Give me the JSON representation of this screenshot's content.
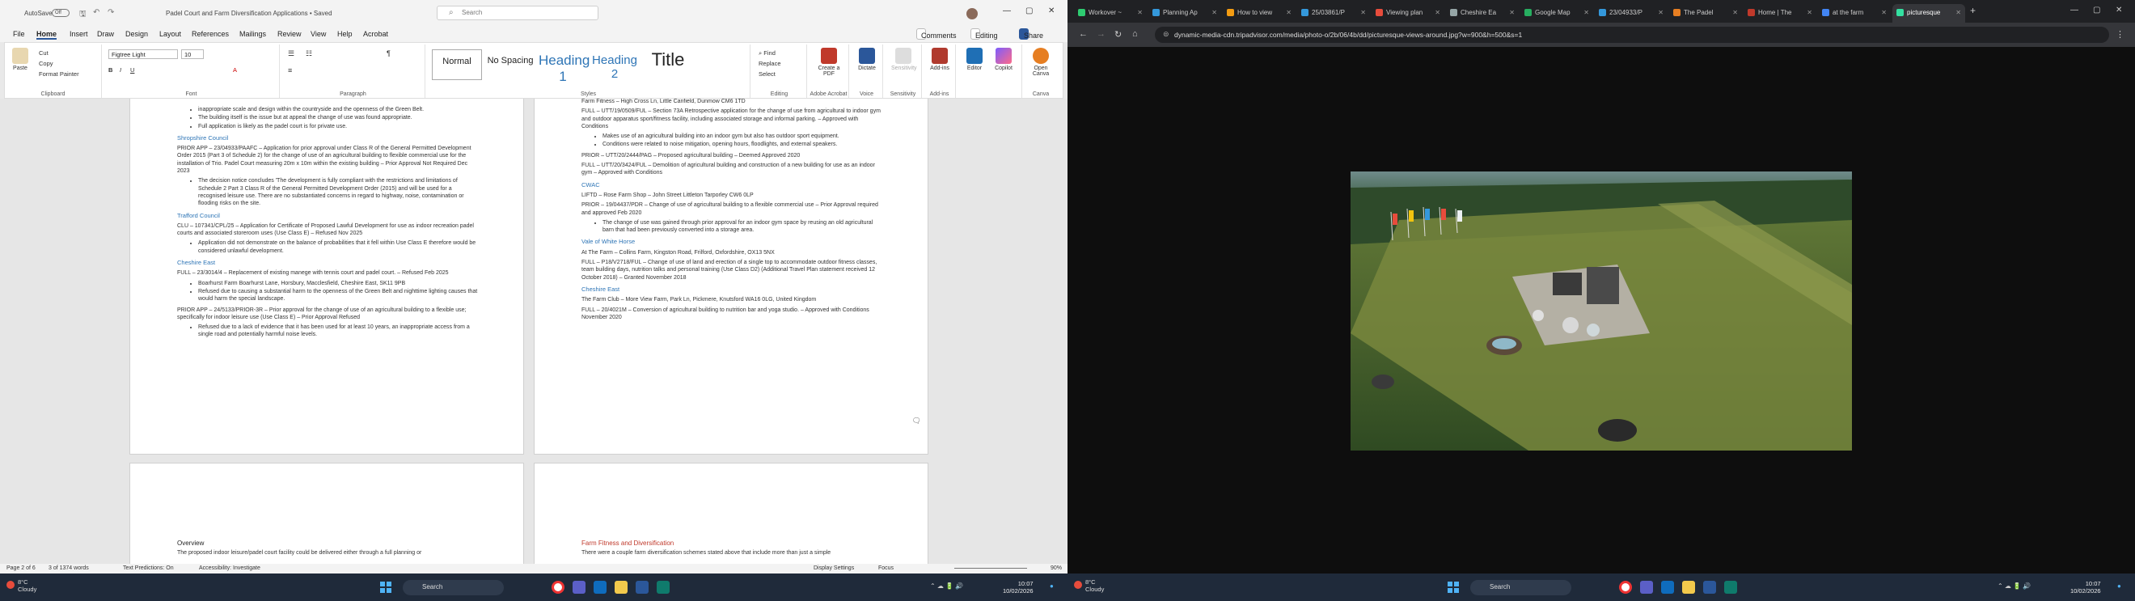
{
  "word": {
    "autosave": "AutoSave",
    "autosave_state": "Off",
    "doc_title": "Padel Court and Farm Diversification Applications • Saved",
    "search_placeholder": "Search",
    "menu": [
      "File",
      "Home",
      "Insert",
      "Draw",
      "Design",
      "Layout",
      "References",
      "Mailings",
      "Review",
      "View",
      "Help",
      "Acrobat"
    ],
    "active_menu": "Home",
    "comments_label": "Comments",
    "editing_label": "Editing",
    "share_label": "Share",
    "ribbon": {
      "paste": "Paste",
      "cut": "Cut",
      "copy": "Copy",
      "format_painter": "Format Painter",
      "clipboard": "Clipboard",
      "font_name": "Figtree Light",
      "font_size": "10",
      "font": "Font",
      "paragraph": "Paragraph",
      "styles_label": "Styles",
      "styles": [
        "Normal",
        "No Spacing",
        "Heading 1",
        "Heading 2",
        "Title"
      ],
      "find": "Find",
      "replace": "Replace",
      "select": "Select",
      "editing": "Editing",
      "create_pdf": "Create a PDF",
      "adobe_acrobat": "Adobe Acrobat",
      "dictate": "Dictate",
      "voice": "Voice",
      "sensitivity": "Sensitivity",
      "sensitivity_group": "Sensitivity",
      "addins": "Add-ins",
      "addins_group": "Add-ins",
      "editor": "Editor",
      "copilot": "Copilot",
      "open_canva": "Open Canva",
      "canva": "Canva"
    },
    "page1": {
      "top_lines": [
        "inappropriate scale and design within the countryside and the openness of the Green Belt.",
        "The building itself is the issue but at appeal the change of use was found appropriate.",
        "Full application is likely as the padel court is for private use."
      ],
      "shropshire": "Shropshire Council",
      "shrop_p": "PRIOR APP – 23/04933/PAAFC – Application for prior approval under Class R of the General Permitted Development Order 2015 (Part 3 of Schedule 2) for the change of use of an agricultural building to flexible commercial use for the installation of Trio. Padel Court measuring 20m x 10m within the existing building – Prior Approval Not Required Dec 2023",
      "shrop_li": "The decision notice concludes 'The development is fully compliant with the restrictions and limitations of Schedule 2 Part 3 Class R of the General Permitted Development Order (2015) and will be used for a recognised leisure use. There are no substantiated concerns in regard to highway, noise, contamination or flooding risks on the site.",
      "trafford": "Trafford Council",
      "traff_p": "CLU – 107341/CPL/25 – Application for Certificate of Proposed Lawful Development for use as indoor recreation padel courts and associated storeroom uses (Use Class E) – Refused Nov 2025",
      "traff_li": "Application did not demonstrate on the balance of probabilities that it fell within Use Class E therefore would be considered unlawful development.",
      "cheshire": "Cheshire East",
      "ches_p1": "FULL – 23/3014/4 – Replacement of existing manege with tennis court and padel court. – Refused Feb 2025",
      "ches_li1": "Boarhurst Farm Boarhurst Lane, Horsbury, Macclesfield, Cheshire East, SK11 9PB",
      "ches_li2": "Refused due to causing a substantial harm to the openness of the Green Belt and nighttime lighting causes that would harm the special landscape.",
      "ches_p2": "PRIOR APP – 24/5133/PRIOR-3R – Prior approval for the change of use of an agricultural building to a flexible use; specifically for indoor leisure use (Use Class E) – Prior Approval Refused",
      "ches_li3": "Refused due to a lack of evidence that it has been used for at least 10 years, an inappropriate access from a single road and potentially harmful noise levels."
    },
    "page2": {
      "l1": "Farm Fitness – High Cross Ln, Little Canfield, Dunmow CM6 1TD",
      "l2": "FULL – UTT/19/0509/FUL – Section 73A Retrospective application for the change of use from agricultural to indoor gym and outdoor apparatus sport/fitness facility, including associated storage and informal parking. – Approved with Conditions",
      "li1": "Makes use of an agricultural building into an indoor gym but also has outdoor sport equipment.",
      "li2": "Conditions were related to noise mitigation, opening hours, floodlights, and external speakers.",
      "l3": "PRIOR – UTT/20/2444/PAG – Proposed agricultural building – Deemed Approved 2020",
      "l4": "FULL – UTT/20/3424/FUL – Demolition of agricultural building and construction of a new building for use as an indoor gym – Approved with Conditions",
      "cwac": "CWAC",
      "l5": "LIFTD – Rose Farm Shop – John Street Littleton Tarporley CW6 0LP",
      "l6": "PRIOR – 19/04437/PDR – Change of use of agricultural building to a flexible commercial use – Prior Approval required and approved Feb 2020",
      "li3": "The change of use was gained through prior approval for an indoor gym space by reusing an old agricultural barn that had been previously converted into a storage area.",
      "vwh": "Vale of White Horse",
      "l7": "At The Farm – Collins Farm, Kingston Road, Frilford, Oxfordshire, OX13 5NX",
      "l8": "FULL – P18/V2718/FUL – Change of use of land and erection of a single top to accommodate outdoor fitness classes, team building days, nutrition talks and personal training (Use Class D2) (Additional Travel Plan statement received 12 October 2018) – Granted November 2018",
      "cheshire2": "Cheshire East",
      "l9": "The Farm Club – More View Farm, Park Ln, Pickmere, Knutsford WA16 0LG, United Kingdom",
      "l10": "FULL – 20/4021M – Conversion of agricultural building to nutrition bar and yoga studio. – Approved with Conditions November 2020"
    },
    "page3": {
      "title": "Overview",
      "text": "The proposed indoor leisure/padel court facility could be delivered either through a full planning or"
    },
    "page4": {
      "title": "Farm Fitness and Diversification",
      "text": "There were a couple farm diversification schemes stated above that include more than just a simple"
    },
    "status": {
      "page": "Page 2 of 6",
      "words": "3 of 1374 words",
      "text_predictions": "Text Predictions: On",
      "accessibility": "Accessibility: Investigate",
      "display": "Display Settings",
      "focus": "Focus",
      "zoom": "90%"
    }
  },
  "taskbar_left": {
    "temp": "8°C",
    "weather": "Cloudy",
    "search": "Search",
    "time": "10:07",
    "date": "10/02/2026"
  },
  "browser": {
    "tabs": [
      {
        "label": "Workover ~",
        "color": "#2ecc71"
      },
      {
        "label": "Planning Ap",
        "color": "#3498db"
      },
      {
        "label": "How to view",
        "color": "#f39c12"
      },
      {
        "label": "25/03861/P",
        "color": "#3498db"
      },
      {
        "label": "Viewing plan",
        "color": "#e74c3c"
      },
      {
        "label": "Cheshire Ea",
        "color": "#95a5a6"
      },
      {
        "label": "Google Map",
        "color": "#27ae60"
      },
      {
        "label": "23/04933/P",
        "color": "#3498db"
      },
      {
        "label": "The Padel",
        "color": "#e67e22"
      },
      {
        "label": "Home | The",
        "color": "#c0392b"
      },
      {
        "label": "at the farm",
        "color": "#4285f4"
      },
      {
        "label": "picturesque",
        "color": "#34e0a1"
      }
    ],
    "url": "dynamic-media-cdn.tripadvisor.com/media/photo-o/2b/06/4b/dd/picturesque-views-around.jpg?w=900&h=500&s=1"
  },
  "taskbar_right": {
    "temp": "8°C",
    "weather": "Cloudy",
    "search": "Search",
    "time": "10:07",
    "date": "10/02/2026"
  }
}
